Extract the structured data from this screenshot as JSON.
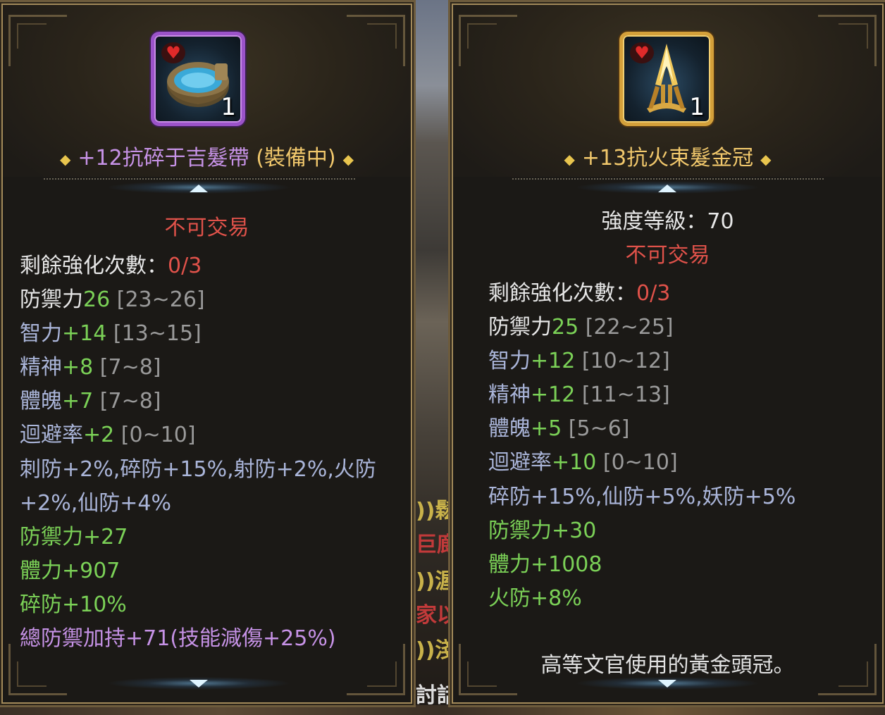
{
  "scene": {
    "fragments": [
      "))鬆",
      "巨廊",
      "))渥",
      "家以",
      "))淺",
      "討話"
    ]
  },
  "left_tooltip": {
    "item_name": "+12抗碎于吉髮帶",
    "item_status": "(裝備中)",
    "quantity": "1",
    "icon": "headband-icon",
    "frame_color": "#9b53c9",
    "trade": "不可交易",
    "enhance_label": "剩餘強化次數：",
    "enhance_value": "0/3",
    "stats": [
      {
        "name": "防禦力",
        "value": "26",
        "range": "[23~26]"
      },
      {
        "name": "智力",
        "value": "+14",
        "range": "[13~15]"
      },
      {
        "name": "精神",
        "value": "+8",
        "range": "[7~8]"
      },
      {
        "name": "體魄",
        "value": "+7",
        "range": "[7~8]"
      },
      {
        "name": "迴避率",
        "value": "+2",
        "range": "[0~10]"
      }
    ],
    "resist_line1": "刺防+2%,碎防+15%,射防+2%,火防",
    "resist_line2": "+2%,仙防+4%",
    "bonus": [
      "防禦力+27",
      "體力+907",
      "碎防+10%"
    ],
    "set_bonus": "總防禦加持+71(技能減傷+25%)"
  },
  "right_tooltip": {
    "item_name": "+13抗火束髮金冠",
    "quantity": "1",
    "icon": "golden-crown-icon",
    "frame_color": "#d4a03a",
    "level_label": "強度等級：",
    "level_value": "70",
    "trade": "不可交易",
    "enhance_label": "剩餘強化次數：",
    "enhance_value": "0/3",
    "stats": [
      {
        "name": "防禦力",
        "value": "25",
        "range": "[22~25]"
      },
      {
        "name": "智力",
        "value": "+12",
        "range": "[10~12]"
      },
      {
        "name": "精神",
        "value": "+12",
        "range": "[11~13]"
      },
      {
        "name": "體魄",
        "value": "+5",
        "range": "[5~6]"
      },
      {
        "name": "迴避率",
        "value": "+10",
        "range": "[0~10]"
      }
    ],
    "resist_line1": "碎防+15%,仙防+5%,妖防+5%",
    "bonus": [
      "防禦力+30",
      "體力+1008",
      "火防+8%"
    ],
    "description": "高等文官使用的黃金頭冠。"
  }
}
